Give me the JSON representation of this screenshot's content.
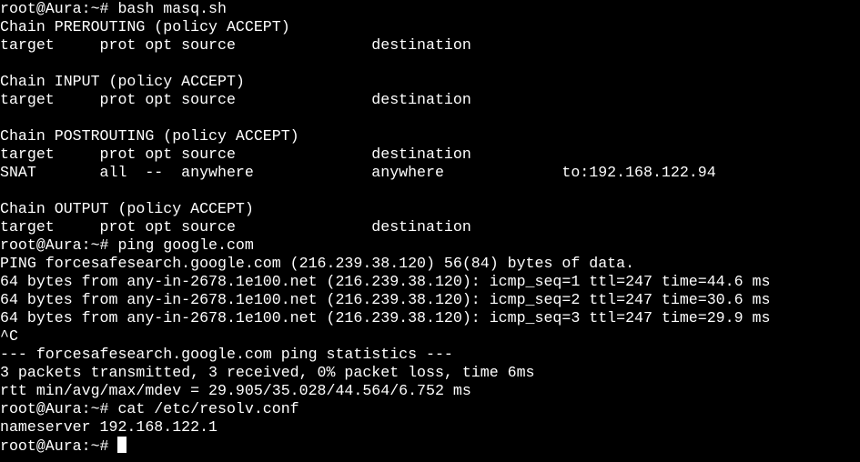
{
  "terminal": {
    "colors": {
      "background": "#000000",
      "foreground": "#ffffff",
      "cursor": "#ffffff"
    },
    "lines": [
      "root@Aura:~# bash masq.sh",
      "Chain PREROUTING (policy ACCEPT)",
      "target     prot opt source               destination",
      "",
      "Chain INPUT (policy ACCEPT)",
      "target     prot opt source               destination",
      "",
      "Chain POSTROUTING (policy ACCEPT)",
      "target     prot opt source               destination",
      "SNAT       all  --  anywhere             anywhere             to:192.168.122.94",
      "",
      "Chain OUTPUT (policy ACCEPT)",
      "target     prot opt source               destination",
      "root@Aura:~# ping google.com",
      "PING forcesafesearch.google.com (216.239.38.120) 56(84) bytes of data.",
      "64 bytes from any-in-2678.1e100.net (216.239.38.120): icmp_seq=1 ttl=247 time=44.6 ms",
      "64 bytes from any-in-2678.1e100.net (216.239.38.120): icmp_seq=2 ttl=247 time=30.6 ms",
      "64 bytes from any-in-2678.1e100.net (216.239.38.120): icmp_seq=3 ttl=247 time=29.9 ms",
      "^C",
      "--- forcesafesearch.google.com ping statistics ---",
      "3 packets transmitted, 3 received, 0% packet loss, time 6ms",
      "rtt min/avg/max/mdev = 29.905/35.028/44.564/6.752 ms",
      "root@Aura:~# cat /etc/resolv.conf",
      "nameserver 192.168.122.1"
    ],
    "current_prompt": "root@Aura:~# ",
    "cursor_icon": "block-cursor-icon"
  }
}
